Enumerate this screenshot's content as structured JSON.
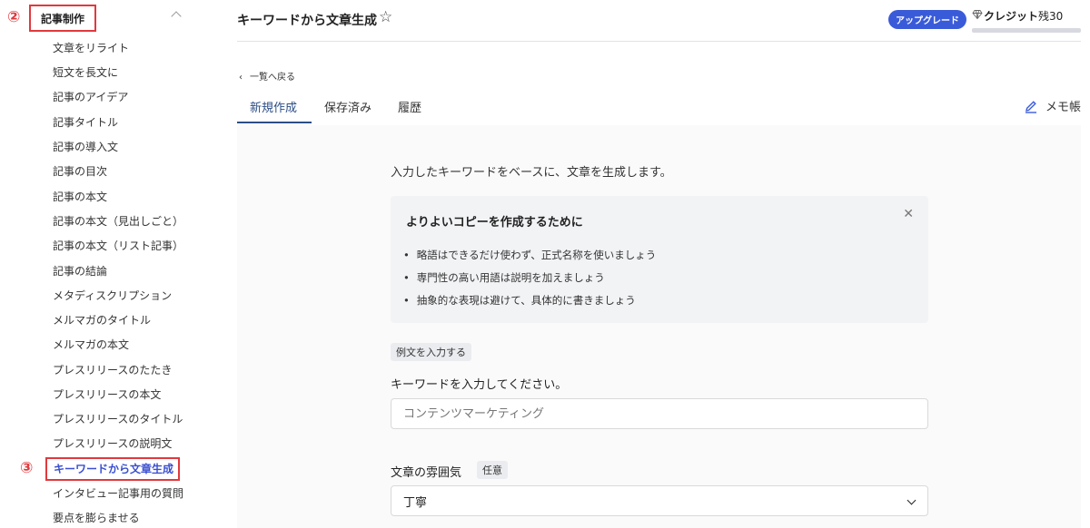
{
  "sidebar": {
    "section_label": "記事制作",
    "annotation_section": "②",
    "annotation_active": "③",
    "items": [
      "文章をリライト",
      "短文を長文に",
      "記事のアイデア",
      "記事タイトル",
      "記事の導入文",
      "記事の目次",
      "記事の本文",
      "記事の本文（見出しごと）",
      "記事の本文（リスト記事）",
      "記事の結論",
      "メタディスクリプション",
      "メルマガのタイトル",
      "メルマガの本文",
      "プレスリリースのたたき",
      "プレスリリースの本文",
      "プレスリリースのタイトル",
      "プレスリリースの説明文",
      "キーワードから文章生成",
      "インタビュー記事用の質問",
      "要点を膨らませる"
    ]
  },
  "header": {
    "title": "キーワードから文章生成",
    "upgrade_label": "アップグレード",
    "credit_label": "クレジット",
    "credit_remaining": "残30"
  },
  "nav": {
    "back_label": "一覧へ戻る",
    "tabs": [
      "新規作成",
      "保存済み",
      "履歴"
    ],
    "memo_label": "メモ帳"
  },
  "content": {
    "description": "入力したキーワードをベースに、文章を生成します。",
    "tip_title": "よりよいコピーを作成するために",
    "tips": [
      "略語はできるだけ使わず、正式名称を使いましょう",
      "専門性の高い用語は説明を加えましょう",
      "抽象的な表現は避けて、具体的に書きましょう"
    ],
    "example_button": "例文を入力する",
    "keyword_label": "キーワードを入力してください。",
    "keyword_placeholder": "コンテンツマーケティング",
    "mood_label": "文章の雰囲気",
    "optional_badge": "任意",
    "mood_value": "丁寧"
  },
  "colors": {
    "accent": "#3a5bd9",
    "annotation": "#e0393e",
    "tab_active": "#2c4e87"
  }
}
